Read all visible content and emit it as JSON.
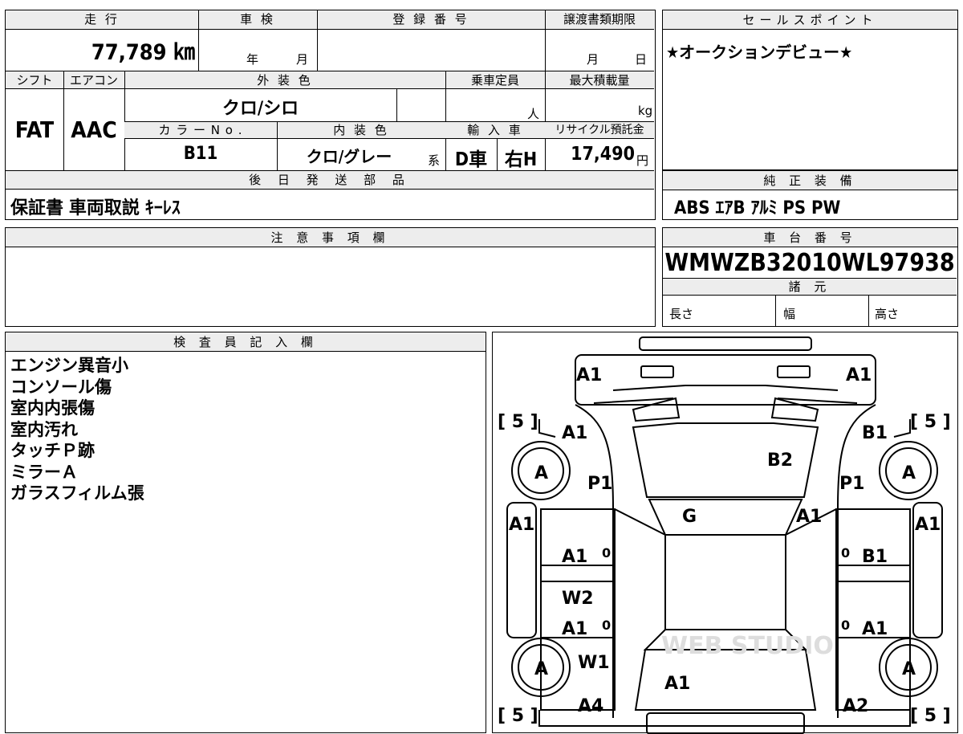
{
  "top_table": {
    "headers": {
      "mileage": "走 行",
      "inspection": "車 検",
      "registration": "登 録 番 号",
      "transfer_deadline": "譲渡書類期限",
      "shift": "シフト",
      "aircon": "エアコン",
      "exterior_color": "外 装 色",
      "capacity": "乗車定員",
      "max_load": "最大積載量",
      "color_no": "カ ラ ー N o .",
      "interior_color": "内 装 色",
      "import": "輸 入 車",
      "recycle_fee": "リサイクル預託金",
      "later_parts": "後 日 発 送 部 品"
    },
    "mileage_value": "77,789 ㎞",
    "inspection_year_unit": "年",
    "inspection_month_unit": "月",
    "deadline_month_unit": "月",
    "deadline_day_unit": "日",
    "shift_value": "FAT",
    "aircon_value": "AAC",
    "exterior_color_value": "クロ/シロ",
    "capacity_unit": "人",
    "load_unit": "kg",
    "color_no_value": "B11",
    "interior_color_value": "クロ/グレー",
    "interior_suffix": "系",
    "import_value": "D車",
    "handle_value": "右H",
    "recycle_value": "17,490",
    "recycle_unit": "円",
    "later_parts_value": "保証書 車両取説 ｷｰﾚｽ"
  },
  "sales_point": {
    "header": "セールスポイント",
    "text": "★オークションデビュー★"
  },
  "equipment": {
    "header": "純 正 装 備",
    "value": "ABS ｴｱB ｱﾙﾐ PS PW"
  },
  "notes": {
    "header": "注 意 事 項 欄"
  },
  "chassis": {
    "header": "車 台 番 号",
    "value": "WMWZB32010WL97938",
    "specs_header": "諸 元",
    "length": "長さ",
    "width": "幅",
    "height": "高さ"
  },
  "inspector": {
    "header": "検 査 員 記 入 欄",
    "lines": [
      "エンジン異音小",
      "コンソール傷",
      "室内内張傷",
      "室内汚れ",
      "タッチＰ跡",
      "ミラーＡ",
      "ガラスフィルム張"
    ]
  },
  "diagram": {
    "watermark": "WEB STUDIO",
    "tire_left_top": "[ 5 ]",
    "tire_right_top": "[ 5 ]",
    "tire_left_bottom": "[ 5 ]",
    "tire_right_bottom": "[ 5 ]",
    "marks": {
      "front_left": "A1",
      "front_right": "A1",
      "fender_left": "A1",
      "fender_right": "B1",
      "hood": "B2",
      "wheel_fl": "A",
      "wheel_fr": "A",
      "pillar_left": "P1",
      "pillar_right": "P1",
      "windshield": "G",
      "a_pillar_right": "A1",
      "side_left": "A1",
      "side_right": "A1",
      "door_fl": "A1",
      "door_fr": "B1",
      "door_fl_num": "0",
      "door_fr_num": "0",
      "door_rl_num": "0",
      "door_rr_num": "0",
      "sill_left": "W2",
      "door_rl": "A1",
      "door_rr": "A1",
      "wheel_rl": "A",
      "wheel_rr": "A",
      "quarter_left": "W1",
      "trunk": "A1",
      "rear_left": "A4",
      "rear_right": "A2"
    }
  }
}
